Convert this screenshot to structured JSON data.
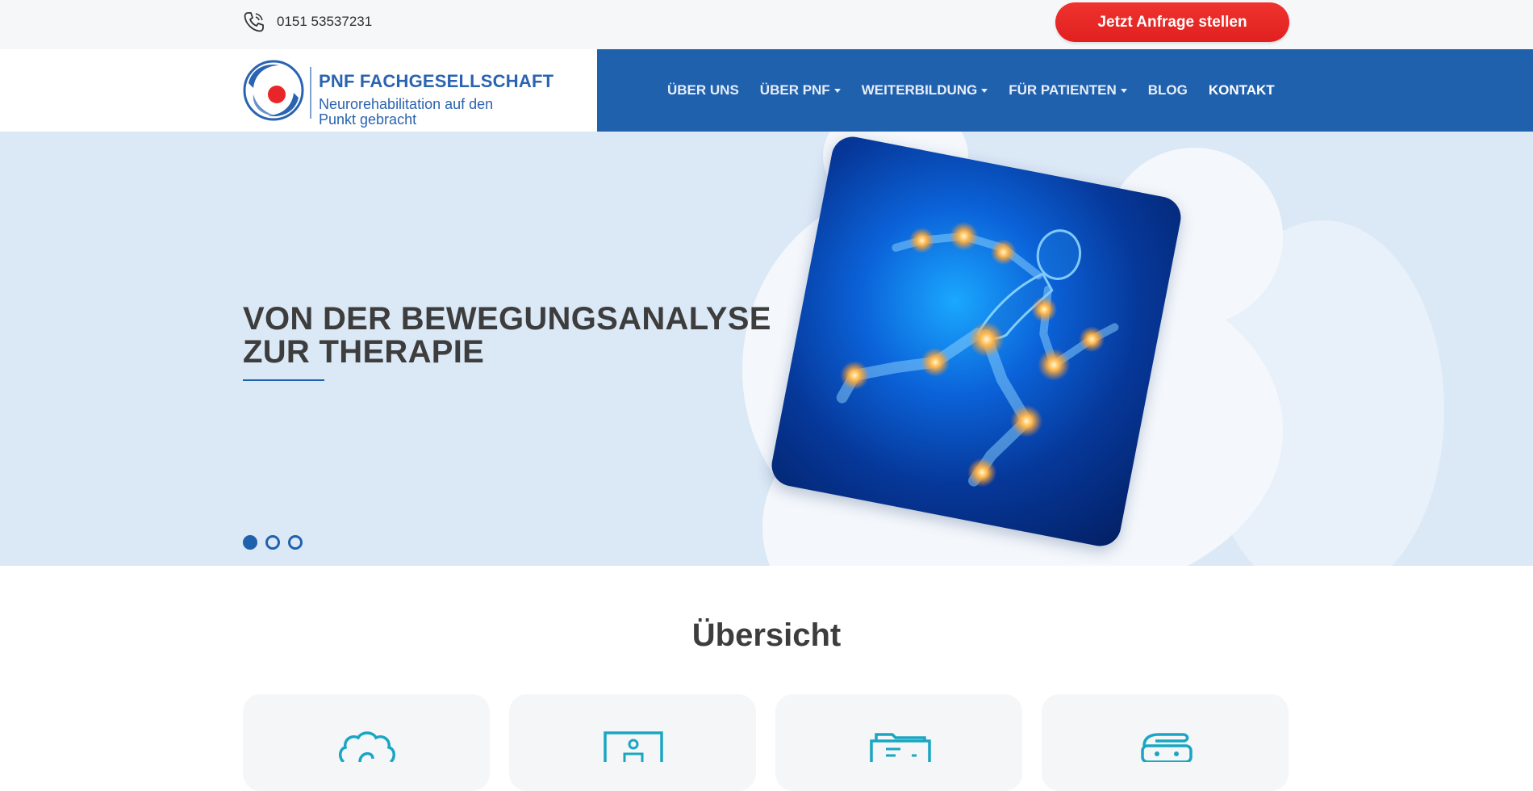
{
  "topbar": {
    "phone_icon": "phone-icon",
    "phone": "0151 53537231",
    "cta_label": "Jetzt Anfrage stellen"
  },
  "logo": {
    "title": "PNF FACHGESELLSCHAFT",
    "subtitle": "Neurorehabilitation auf den Punkt gebracht"
  },
  "nav": {
    "items": [
      {
        "label": "ÜBER UNS",
        "dropdown": false
      },
      {
        "label": "ÜBER PNF",
        "dropdown": true
      },
      {
        "label": "WEITERBILDUNG",
        "dropdown": true
      },
      {
        "label": "FÜR PATIENTEN",
        "dropdown": true
      },
      {
        "label": "BLOG",
        "dropdown": false
      },
      {
        "label": "KONTAKT",
        "dropdown": false,
        "active": true
      }
    ]
  },
  "hero": {
    "title": "VON DER BEWEGUNGSANALYSE ZUR THERAPIE",
    "slides": 3,
    "active_slide": 1,
    "image": "running-figure-joints-illustration"
  },
  "overview": {
    "title": "Übersicht",
    "cards": [
      {
        "icon": "brain-icon"
      },
      {
        "icon": "presentation-board-icon"
      },
      {
        "icon": "folder-briefcase-icon"
      },
      {
        "icon": "massage-table-icon"
      }
    ]
  },
  "colors": {
    "brand_blue": "#2061ae",
    "cta_red": "#e8262a",
    "hero_bg": "#dbe8f6",
    "icon_teal": "#1aa6c2"
  }
}
